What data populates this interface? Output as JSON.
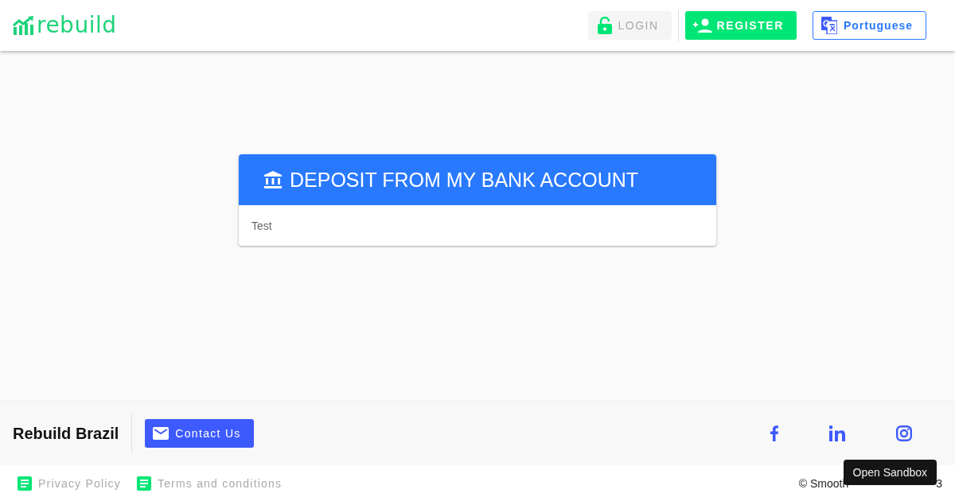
{
  "header": {
    "logo": "rebuild",
    "login": {
      "label": "LOGIN",
      "disabled": true
    },
    "register": {
      "label": "REGISTER"
    },
    "language": {
      "label": "Portuguese"
    }
  },
  "card": {
    "title": "DEPOSIT FROM MY BANK ACCOUNT",
    "body": "Test"
  },
  "footer": {
    "brand": "Rebuild Brazil",
    "contact": "Contact Us",
    "links": [
      "Privacy Policy",
      "Terms and conditions"
    ],
    "copyright_start": "© Smooth",
    "copyright_end": "3"
  },
  "tooltip": "Open Sandbox"
}
